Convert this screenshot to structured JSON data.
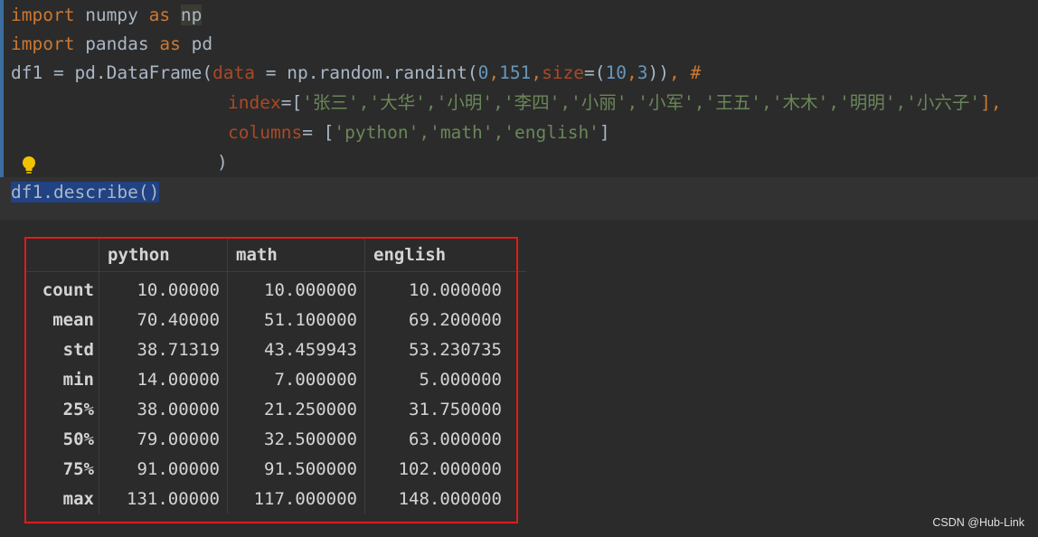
{
  "code": {
    "line1": {
      "kw1": "import",
      "mod": " numpy ",
      "kw2": "as",
      "sp": " ",
      "alias": "np"
    },
    "line2": {
      "kw1": "import",
      "mod": " pandas ",
      "kw2": "as",
      "alias": " pd"
    },
    "line3": {
      "a": "df1 = pd.DataFrame(",
      "p_data": "data",
      "b": " = np.random.randint(",
      "n1": "0",
      "c1": ",",
      "n2": "151",
      "c2": ",",
      "p_size": "size",
      "eq": "=(",
      "n3": "10",
      "c3": ",",
      "n4": "3",
      "d": "))",
      "e": ", #"
    },
    "line4": {
      "p_index": "index",
      "eq": "=[",
      "items": "'张三','大华','小明','李四','小丽','小军','王五','木木','明明','小六子'",
      "end": "],"
    },
    "line5": {
      "p_columns": "columns",
      "eq": "= [",
      "items": "'python','math','english'",
      "end": "]"
    },
    "line6": {
      "paren": ")"
    },
    "line7": {
      "text": "df1.describe()"
    }
  },
  "table": {
    "columns": [
      "python",
      "math",
      "english"
    ],
    "rows": [
      {
        "label": "count",
        "values": [
          "10.00000",
          "10.000000",
          "10.000000"
        ]
      },
      {
        "label": "mean",
        "values": [
          "70.40000",
          "51.100000",
          "69.200000"
        ]
      },
      {
        "label": "std",
        "values": [
          "38.71319",
          "43.459943",
          "53.230735"
        ]
      },
      {
        "label": "min",
        "values": [
          "14.00000",
          "7.000000",
          "5.000000"
        ]
      },
      {
        "label": "25%",
        "values": [
          "38.00000",
          "21.250000",
          "31.750000"
        ]
      },
      {
        "label": "50%",
        "values": [
          "79.00000",
          "32.500000",
          "63.000000"
        ]
      },
      {
        "label": "75%",
        "values": [
          "91.00000",
          "91.500000",
          "102.000000"
        ]
      },
      {
        "label": "max",
        "values": [
          "131.00000",
          "117.000000",
          "148.000000"
        ]
      }
    ]
  },
  "watermark": "CSDN @Hub-Link",
  "icons": {
    "bulb": "lightbulb-icon"
  },
  "colors": {
    "keyword": "#cc7832",
    "number": "#6897bb",
    "string": "#6a8759",
    "param": "#aa4926",
    "highlight_box": "#e31a1a"
  }
}
